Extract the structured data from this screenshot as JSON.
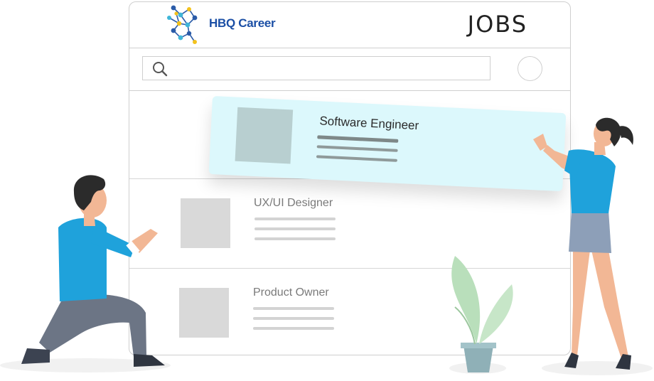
{
  "brand": {
    "name": "HBQ Career"
  },
  "header": {
    "title": "JOBS"
  },
  "search": {
    "placeholder": ""
  },
  "jobs": [
    {
      "title": "Software Engineer",
      "featured": true
    },
    {
      "title": "UX/UI Designer",
      "featured": false
    },
    {
      "title": "Product Owner",
      "featured": false
    }
  ],
  "colors": {
    "brand_blue": "#1b4fa5",
    "featured_card": "#dcf8fc",
    "shirt": "#1fa2db",
    "plant": "#b9dfbb"
  },
  "icons": [
    "search-icon",
    "logo-network-icon",
    "profile-circle-icon"
  ]
}
